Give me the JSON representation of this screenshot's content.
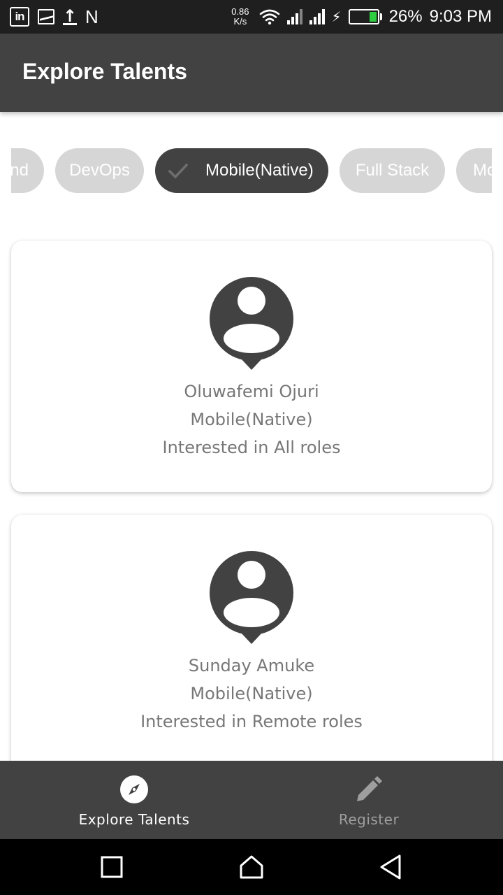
{
  "status_bar": {
    "left_icons": [
      "linkedin-icon",
      "image-icon",
      "upload-icon",
      "n-icon"
    ],
    "linkedin_text": "in",
    "n_text": "N",
    "net_speed_value": "0.86",
    "net_speed_unit": "K/s",
    "battery_percent": "26%",
    "battery_level": 0.26,
    "battery_color": "#2ecc40",
    "time": "9:03 PM"
  },
  "app_bar": {
    "title": "Explore Talents",
    "background": "#424242"
  },
  "chips": [
    {
      "label": "End",
      "selected": false
    },
    {
      "label": "DevOps",
      "selected": false
    },
    {
      "label": "Mobile(Native)",
      "selected": true
    },
    {
      "label": "Full Stack",
      "selected": false
    },
    {
      "label": "Mo",
      "selected": false
    }
  ],
  "cards": [
    {
      "name": "Oluwafemi Ojuri",
      "role": "Mobile(Native)",
      "interest": "Interested in All roles"
    },
    {
      "name": "Sunday Amuke",
      "role": "Mobile(Native)",
      "interest": "Interested in Remote roles"
    }
  ],
  "bottom_nav": {
    "items": [
      {
        "label": "Explore Talents",
        "icon": "compass-icon",
        "active": true
      },
      {
        "label": "Register",
        "icon": "pencil-icon",
        "active": false
      }
    ]
  },
  "system_nav": {
    "buttons": [
      "recents-icon",
      "home-icon",
      "back-icon"
    ]
  }
}
